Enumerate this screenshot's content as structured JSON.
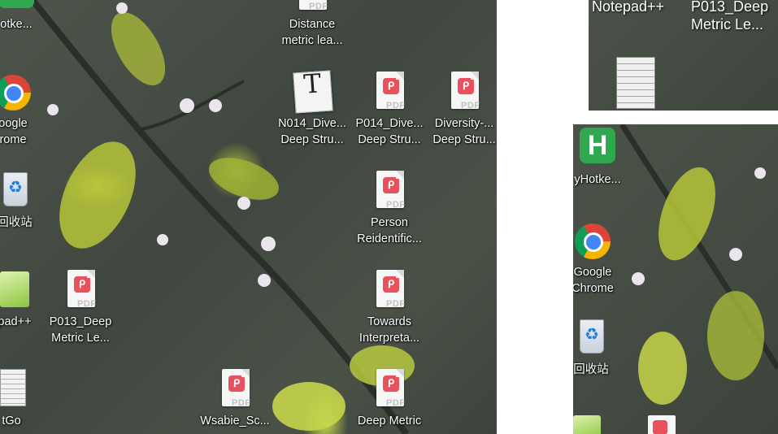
{
  "left_desktop": {
    "icons": [
      {
        "label1": "otke...",
        "label2": "",
        "type": "hotkey"
      },
      {
        "label1": "oogle",
        "label2": "rome",
        "type": "chrome"
      },
      {
        "label1": "回收站",
        "label2": "",
        "type": "recycle"
      },
      {
        "label1": "pad++",
        "label2": "",
        "type": "notepad"
      },
      {
        "label1": "P013_Deep",
        "label2": "Metric Le...",
        "type": "pdf"
      },
      {
        "label1": "tGo",
        "label2": "",
        "type": "text"
      },
      {
        "label1": "Distance",
        "label2": "metric lea...",
        "type": "pdf"
      },
      {
        "label1": "N014_Dive...",
        "label2": "Deep Stru...",
        "type": "typora"
      },
      {
        "label1": "P014_Dive...",
        "label2": "Deep Stru...",
        "type": "pdf"
      },
      {
        "label1": "Diversity-...",
        "label2": "Deep Stru...",
        "type": "pdf"
      },
      {
        "label1": "Person",
        "label2": "Reidentific...",
        "type": "pdf"
      },
      {
        "label1": "Towards",
        "label2": "Interpreta...",
        "type": "pdf"
      },
      {
        "label1": "Wsabie_Sc...",
        "label2": "",
        "type": "pdf"
      },
      {
        "label1": "Deep Metric",
        "label2": "",
        "type": "pdf"
      }
    ]
  },
  "top_right_pane": {
    "label_a": "Notepad++",
    "label_b1": "P013_Deep",
    "label_b2": "Metric Le..."
  },
  "bottom_right_pane": {
    "icons": [
      {
        "label1": "yHotke...",
        "label2": ""
      },
      {
        "label1": "Google",
        "label2": "Chrome"
      },
      {
        "label1": "回收站",
        "label2": ""
      }
    ]
  },
  "glyph_text": {
    "pdf_badge": "ᑭ",
    "pdf_word": "PDF",
    "typora_letter": "T",
    "hotkey_letter": "H",
    "recycle_symbol": "♻"
  }
}
